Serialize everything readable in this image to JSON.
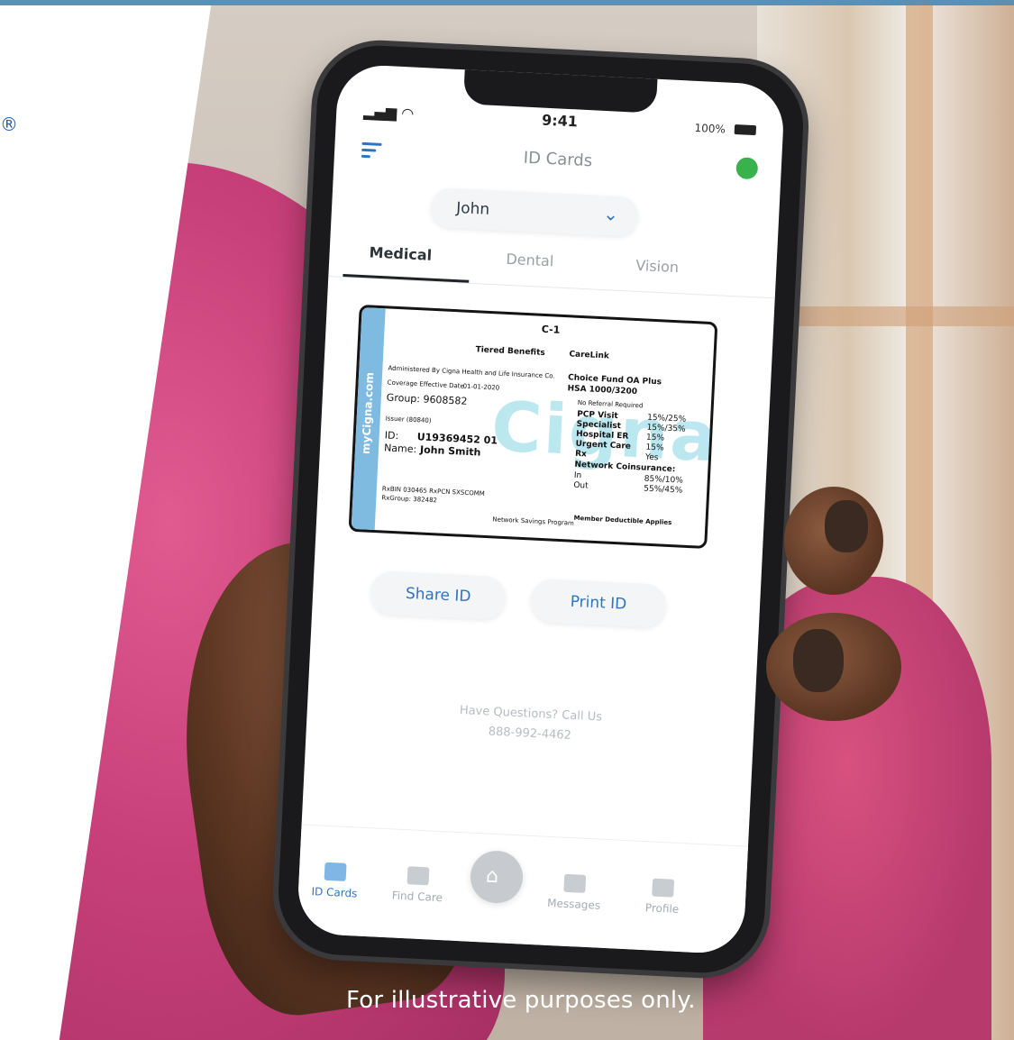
{
  "branding": {
    "registered_mark": "®"
  },
  "phone": {
    "status": {
      "time": "9:41",
      "battery": "100%"
    },
    "header": {
      "title": "ID Cards"
    },
    "member_selector": {
      "selected": "John"
    },
    "tabs": [
      {
        "label": "Medical",
        "active": true
      },
      {
        "label": "Dental",
        "active": false
      },
      {
        "label": "Vision",
        "active": false
      }
    ],
    "id_card": {
      "card_code": "C-1",
      "plan_type": "Tiered Benefits",
      "network_logo": "CareLink",
      "administrator": "Administered By Cigna Health and Life Insurance Co.",
      "coverage_label": "Coverage Effective Date",
      "coverage_date": "01-01-2020",
      "group": "Group: 9608582",
      "issuer": "Issuer (80840)",
      "id_label": "ID:",
      "id_value": "U19369452 01",
      "name_label": "Name:",
      "name_value": "John Smith",
      "strip_text": "myCigna.com",
      "plan_name": "Choice Fund OA Plus",
      "hsa": "HSA 1000/3200",
      "referral": "No Referral Required",
      "benefits": [
        {
          "label": "PCP Visit",
          "value": "15%/25%"
        },
        {
          "label": "Specialist",
          "value": "15%/35%"
        },
        {
          "label": "Hospital ER",
          "value": "15%"
        },
        {
          "label": "Urgent Care",
          "value": "15%"
        },
        {
          "label": "Rx",
          "value": "Yes"
        }
      ],
      "coinsurance_label": "Network Coinsurance:",
      "coinsurance": [
        {
          "label": "In",
          "value": "85%/10%"
        },
        {
          "label": "Out",
          "value": "55%/45%"
        }
      ],
      "rx_line1": "RxBIN 030465 RxPCN SXSCOMM",
      "rx_line2": "RxGroup: 382482",
      "savings_program": "Network Savings Program",
      "deductible_note": "Member Deductible Applies"
    },
    "actions": {
      "share_label": "Share ID",
      "print_label": "Print ID"
    },
    "help": {
      "line1": "Have Questions? Call Us",
      "line2": "888-992-4462"
    },
    "tabbar": [
      {
        "label": "ID Cards",
        "active": true,
        "icon": "id-card-icon"
      },
      {
        "label": "Find Care",
        "active": false,
        "icon": "stethoscope-icon"
      },
      {
        "label": "Messages",
        "active": false,
        "icon": "envelope-icon"
      },
      {
        "label": "Profile",
        "active": false,
        "icon": "person-icon"
      }
    ]
  },
  "caption": "For illustrative purposes only.",
  "colors": {
    "accent": "#2f74c0",
    "shirt": "#c73f79",
    "card_strip": "#7fbbe0"
  }
}
